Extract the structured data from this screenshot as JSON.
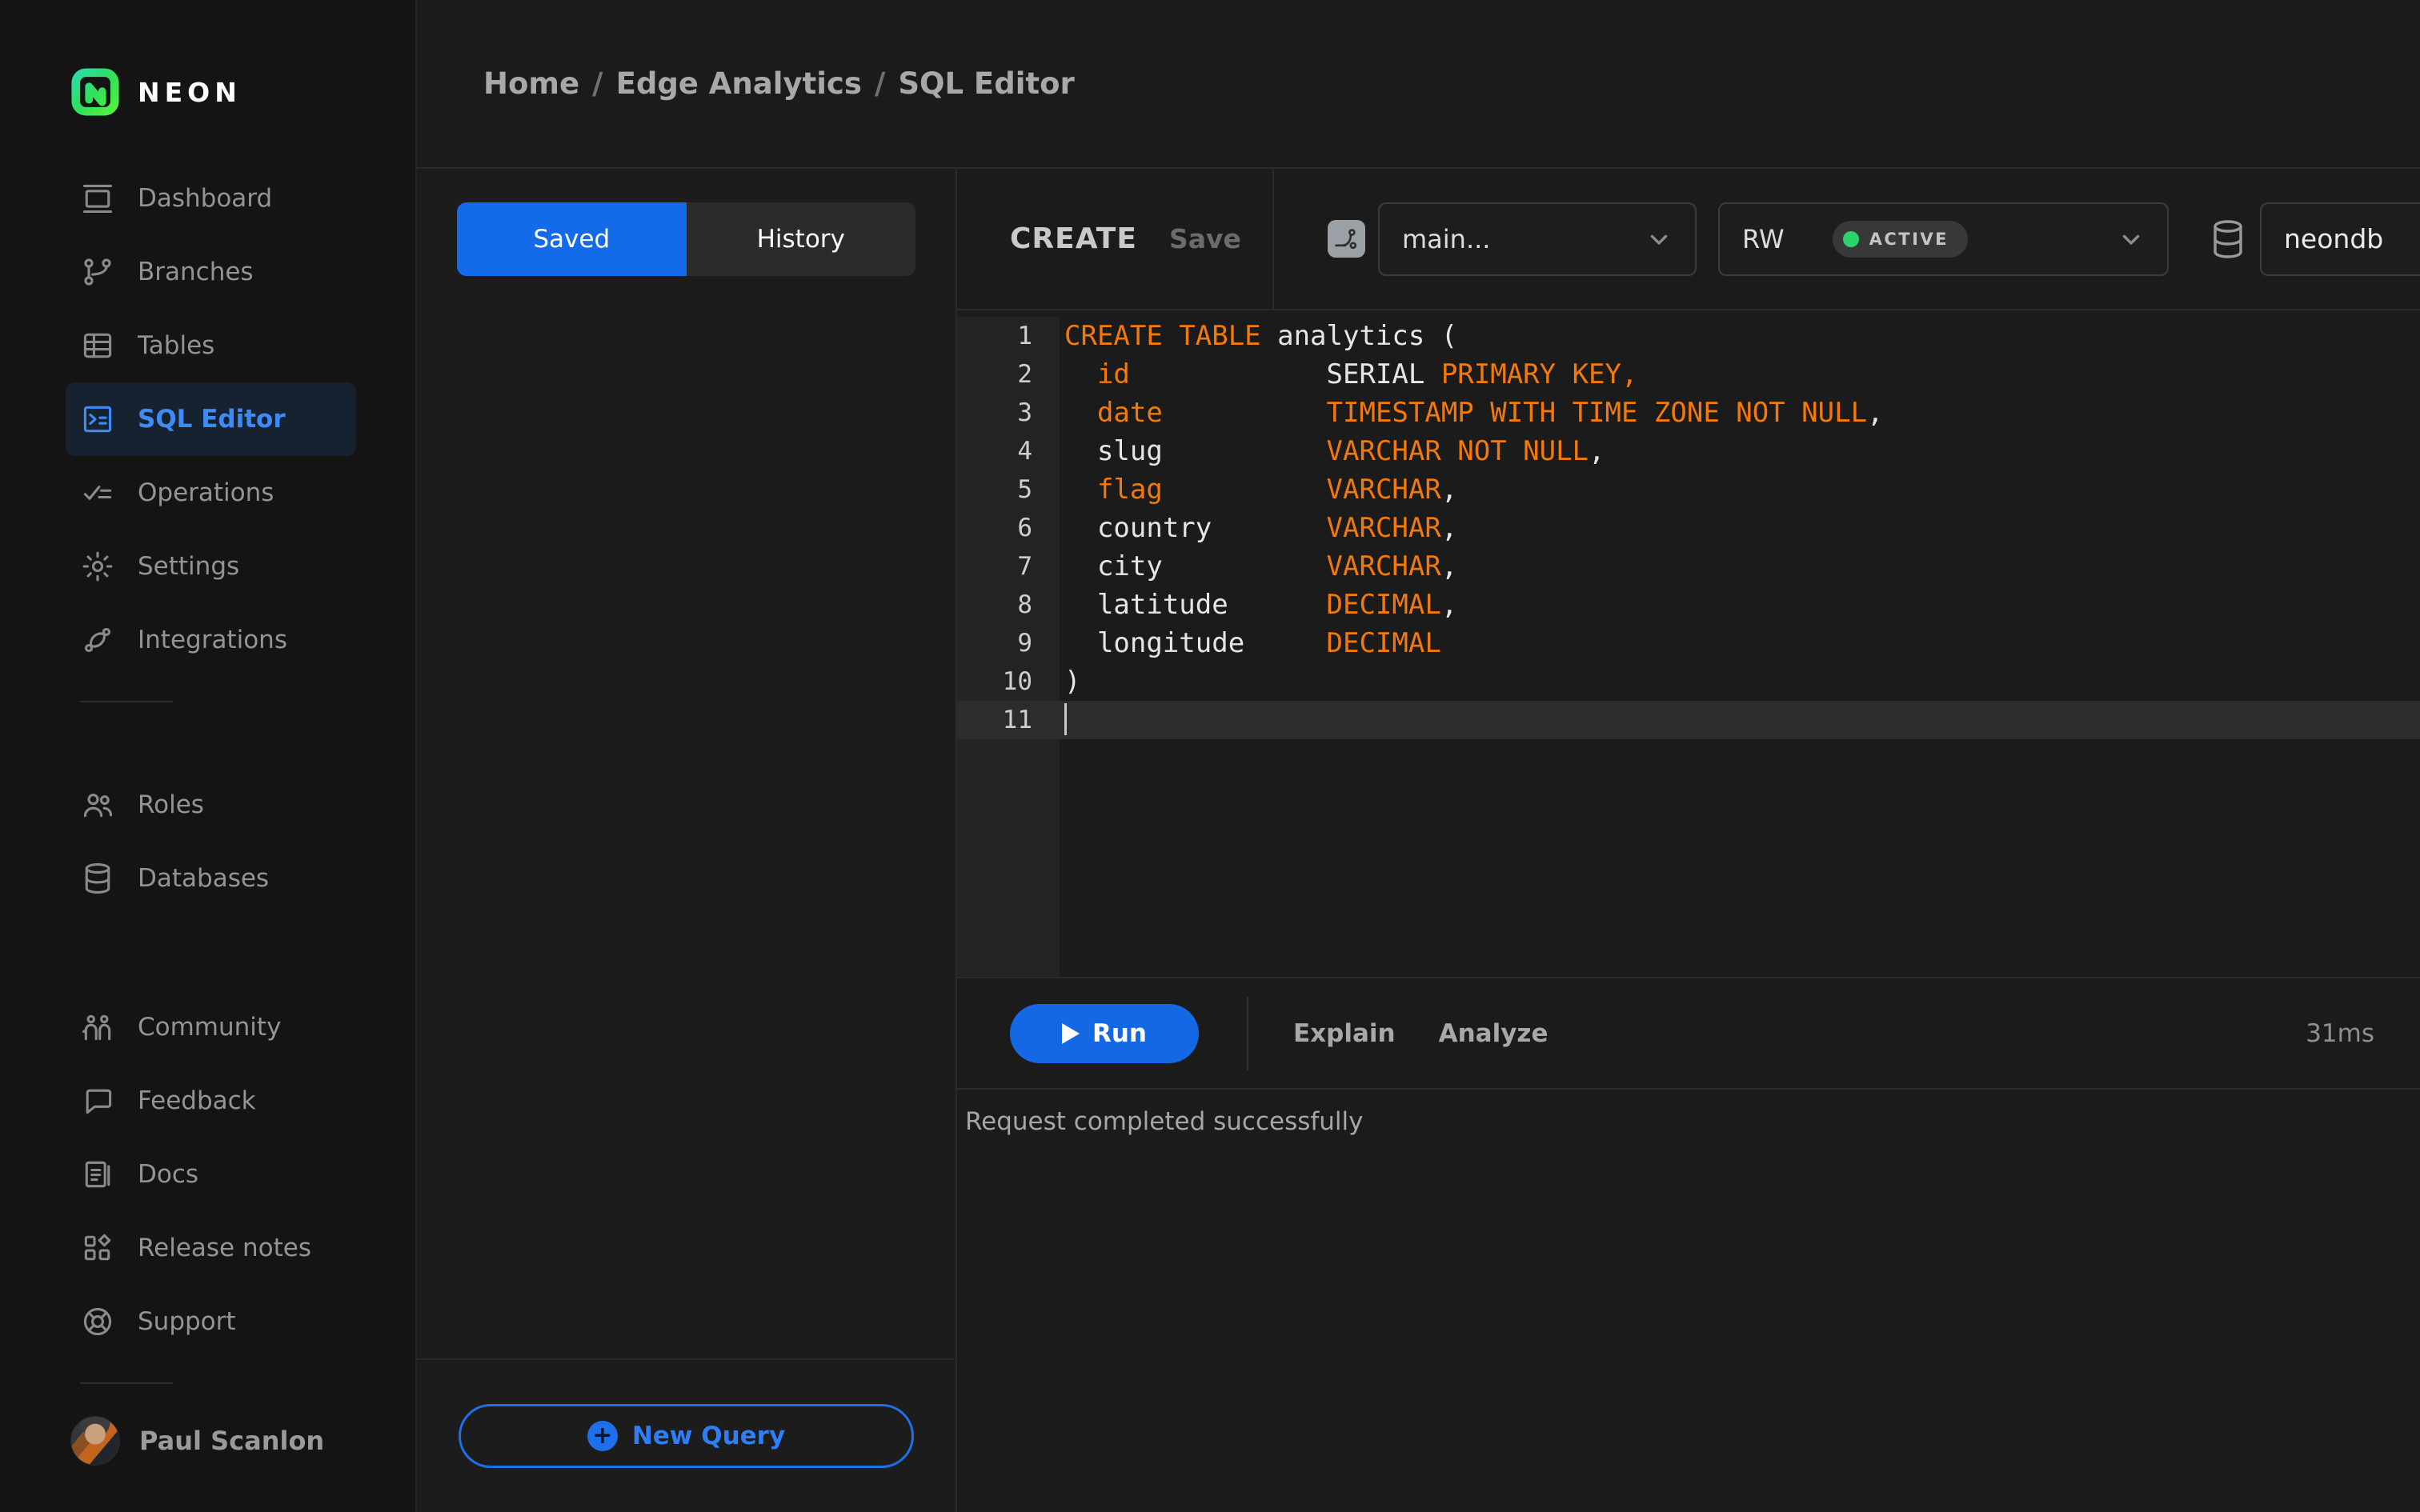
{
  "brand": {
    "name": "NEON"
  },
  "sidebar": {
    "primary": [
      {
        "icon": "dashboard-icon",
        "label": "Dashboard"
      },
      {
        "icon": "branches-icon",
        "label": "Branches"
      },
      {
        "icon": "tables-icon",
        "label": "Tables"
      },
      {
        "icon": "sql-editor-icon",
        "label": "SQL Editor",
        "selected": true
      },
      {
        "icon": "operations-icon",
        "label": "Operations"
      },
      {
        "icon": "settings-icon",
        "label": "Settings"
      },
      {
        "icon": "integrations-icon",
        "label": "Integrations"
      }
    ],
    "secondary": [
      {
        "icon": "roles-icon",
        "label": "Roles"
      },
      {
        "icon": "databases-icon",
        "label": "Databases"
      }
    ],
    "tertiary": [
      {
        "icon": "community-icon",
        "label": "Community"
      },
      {
        "icon": "feedback-icon",
        "label": "Feedback"
      },
      {
        "icon": "docs-icon",
        "label": "Docs"
      },
      {
        "icon": "release-notes-icon",
        "label": "Release notes"
      },
      {
        "icon": "support-icon",
        "label": "Support"
      }
    ],
    "user": {
      "name": "Paul Scanlon"
    }
  },
  "breadcrumb": {
    "items": [
      "Home",
      "Edge Analytics",
      "SQL Editor"
    ],
    "separator": "/"
  },
  "saved_panel": {
    "tabs": [
      {
        "label": "Saved",
        "active": true
      },
      {
        "label": "History",
        "active": false
      }
    ],
    "new_query_label": "New Query"
  },
  "toolbar": {
    "query_title": "CREATE",
    "save_label": "Save",
    "branch": {
      "value": "main..."
    },
    "compute": {
      "value": "RW",
      "status": "ACTIVE"
    },
    "database": {
      "value": "neondb"
    }
  },
  "editor": {
    "cursor_line": 11,
    "lines": [
      {
        "n": 1,
        "tokens": [
          [
            "kw",
            "CREATE TABLE"
          ],
          [
            "d",
            " analytics ("
          ]
        ]
      },
      {
        "n": 2,
        "tokens": [
          [
            "kw",
            "  id"
          ],
          [
            "d",
            "            "
          ],
          [
            "d",
            "SERIAL "
          ],
          [
            "kw",
            "PRIMARY KEY,"
          ]
        ]
      },
      {
        "n": 3,
        "tokens": [
          [
            "kw",
            "  date"
          ],
          [
            "d",
            "          "
          ],
          [
            "kw",
            "TIMESTAMP WITH TIME ZONE NOT NULL"
          ],
          [
            "d",
            ","
          ]
        ]
      },
      {
        "n": 4,
        "tokens": [
          [
            "d",
            "  slug          "
          ],
          [
            "kw",
            "VARCHAR NOT NULL"
          ],
          [
            "d",
            ","
          ]
        ]
      },
      {
        "n": 5,
        "tokens": [
          [
            "kw",
            "  flag"
          ],
          [
            "d",
            "          "
          ],
          [
            "kw",
            "VARCHAR"
          ],
          [
            "d",
            ","
          ]
        ]
      },
      {
        "n": 6,
        "tokens": [
          [
            "d",
            "  country       "
          ],
          [
            "kw",
            "VARCHAR"
          ],
          [
            "d",
            ","
          ]
        ]
      },
      {
        "n": 7,
        "tokens": [
          [
            "d",
            "  city          "
          ],
          [
            "kw",
            "VARCHAR"
          ],
          [
            "d",
            ","
          ]
        ]
      },
      {
        "n": 8,
        "tokens": [
          [
            "d",
            "  latitude      "
          ],
          [
            "kw",
            "DECIMAL"
          ],
          [
            "d",
            ","
          ]
        ]
      },
      {
        "n": 9,
        "tokens": [
          [
            "d",
            "  longitude     "
          ],
          [
            "kw",
            "DECIMAL"
          ]
        ]
      },
      {
        "n": 10,
        "tokens": [
          [
            "d",
            ")"
          ]
        ]
      },
      {
        "n": 11,
        "tokens": []
      }
    ]
  },
  "run_bar": {
    "run_label": "Run",
    "explain_label": "Explain",
    "analyze_label": "Analyze",
    "duration": "31ms"
  },
  "status": {
    "message": "Request completed successfully"
  },
  "colors": {
    "accent_blue": "#1568e4",
    "link_blue": "#3e8bf6",
    "keyword_orange": "#f2790a",
    "active_green": "#2bd46a",
    "sidebar_bg": "#141414",
    "content_bg": "#1b1b1b"
  }
}
